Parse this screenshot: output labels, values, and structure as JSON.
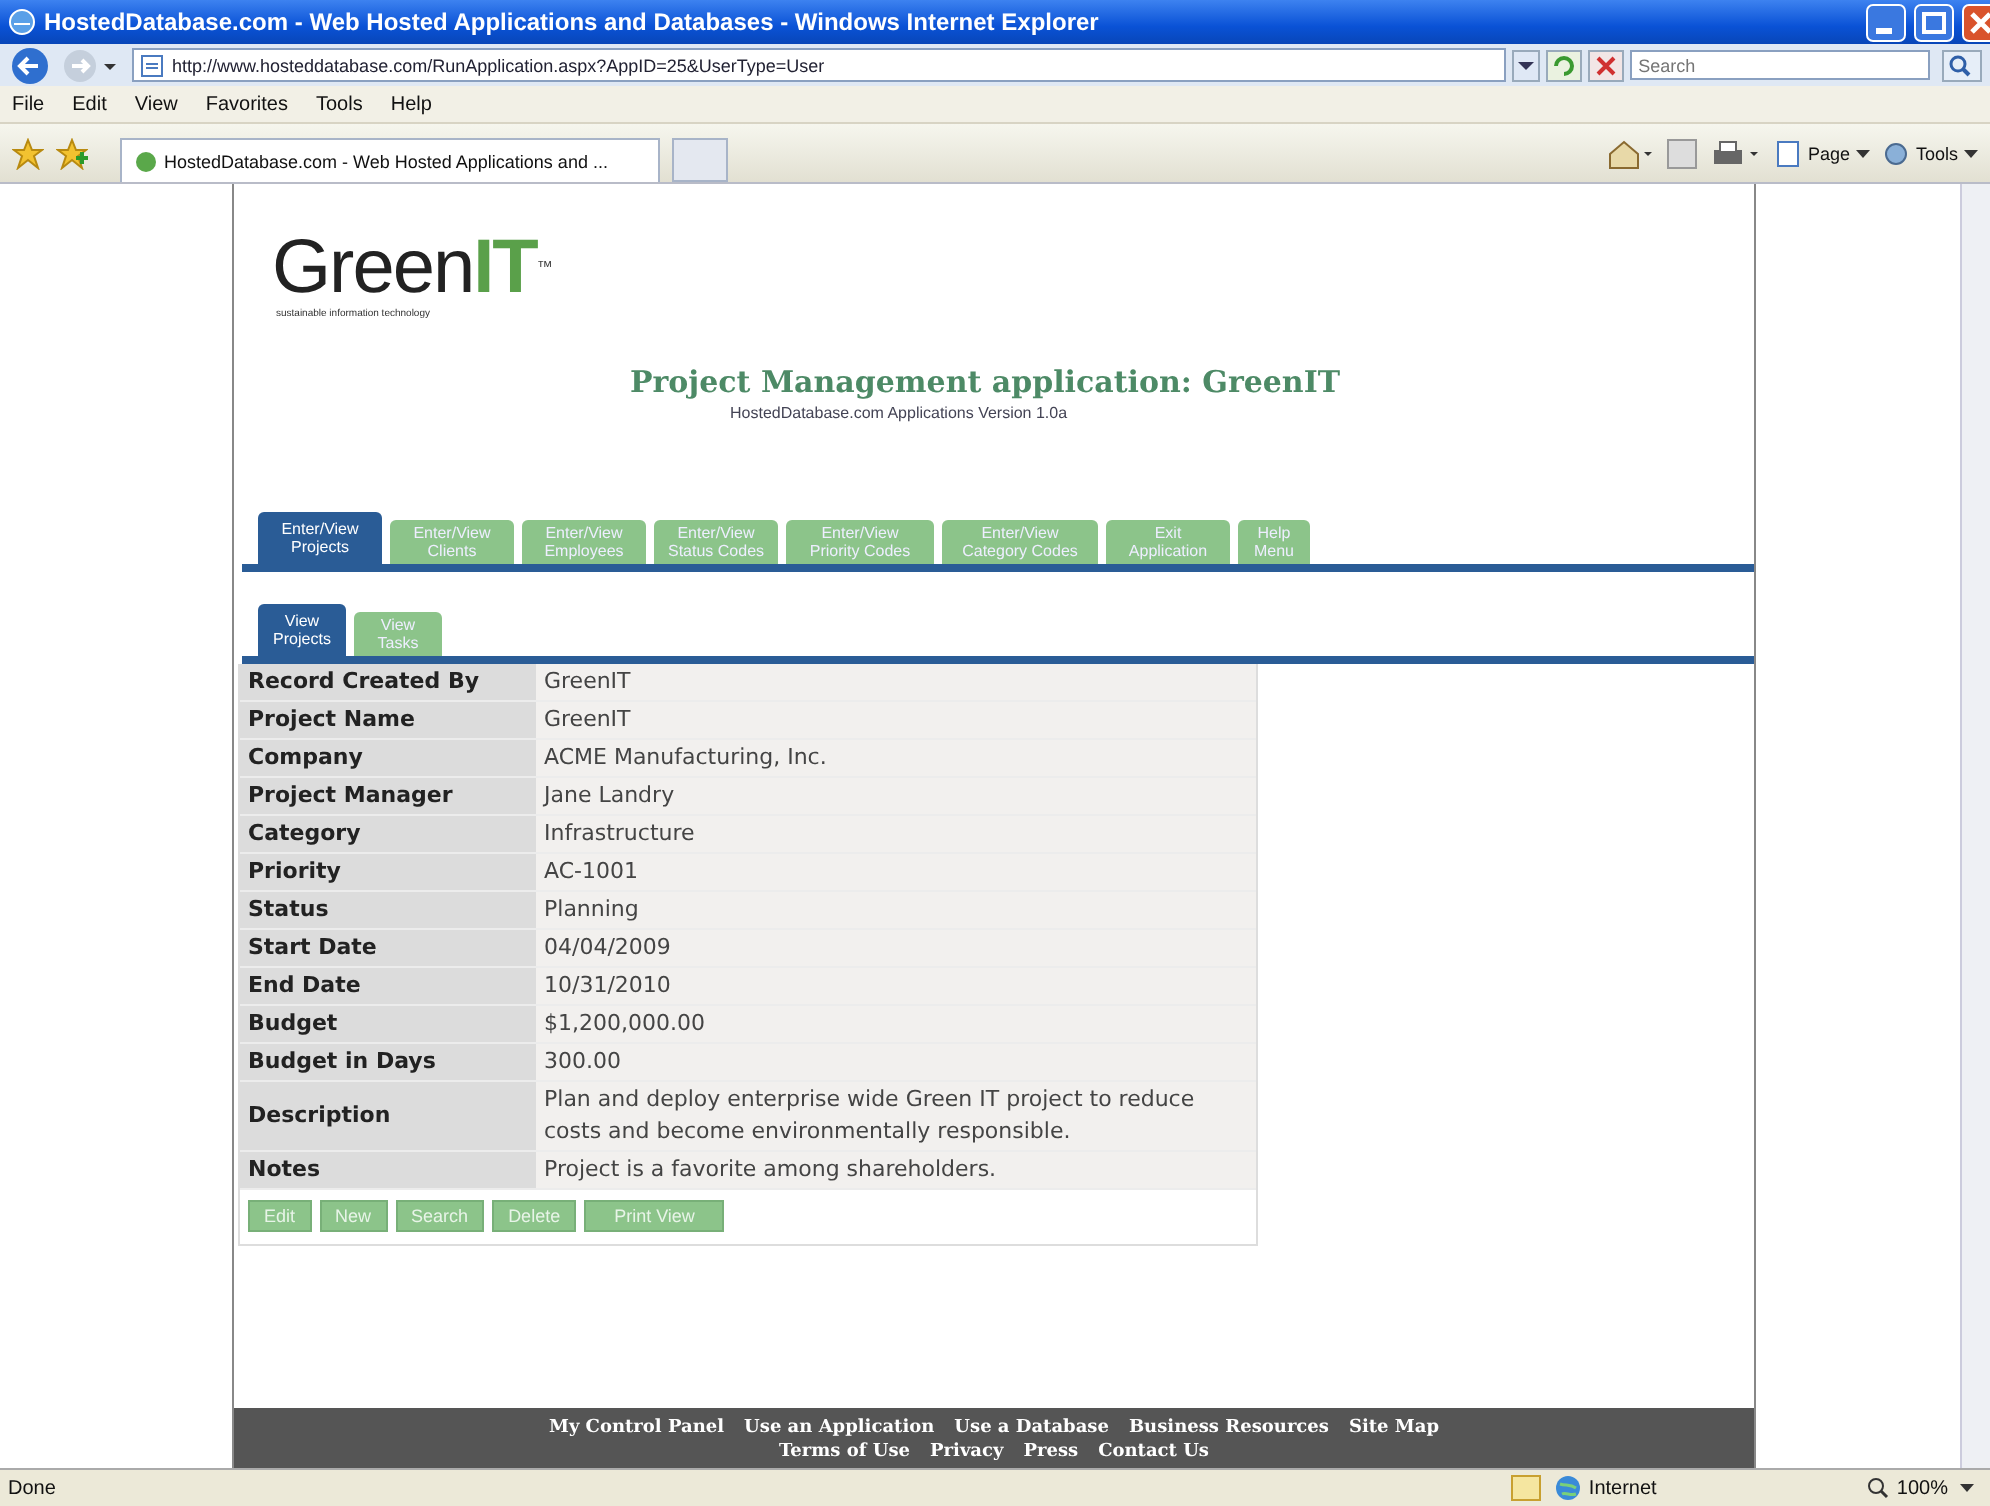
{
  "window": {
    "title": "HostedDatabase.com - Web Hosted Applications and Databases - Windows Internet Explorer"
  },
  "address_bar": {
    "url": "http://www.hosteddatabase.com/RunApplication.aspx?AppID=25&UserType=User"
  },
  "search": {
    "placeholder": "Search"
  },
  "menu": [
    "File",
    "Edit",
    "View",
    "Favorites",
    "Tools",
    "Help"
  ],
  "browser_tabs": [
    {
      "label": "HostedDatabase.com - Web Hosted Applications and ...",
      "selected": true
    }
  ],
  "command_bar": [
    "Page",
    "Tools"
  ],
  "page": {
    "logo": {
      "text": "Green",
      "accent": "IT",
      "mark": "™",
      "tagline": "sustainable information technology"
    },
    "title": "Project Management application: GreenIT",
    "subtitle": "HostedDatabase.com Applications Version 1.0a",
    "tabs": [
      {
        "label": "Enter/View Projects",
        "selected": true
      },
      {
        "label": "Enter/View Clients",
        "selected": false
      },
      {
        "label": "Enter/View Employees",
        "selected": false
      },
      {
        "label": "Enter/View Status Codes",
        "selected": false
      },
      {
        "label": "Enter/View Priority Codes",
        "selected": false
      },
      {
        "label": "Enter/View Category Codes",
        "selected": false
      },
      {
        "label": "Exit Application",
        "selected": false
      },
      {
        "label": "Help Menu",
        "selected": false
      }
    ],
    "subtabs": [
      {
        "label": "View Projects",
        "selected": true
      },
      {
        "label": "View Tasks",
        "selected": false
      }
    ],
    "record": [
      {
        "label": "Record Created By",
        "value": "GreenIT"
      },
      {
        "label": "Project Name",
        "value": "GreenIT"
      },
      {
        "label": "Company",
        "value": "ACME Manufacturing, Inc."
      },
      {
        "label": "Project Manager",
        "value": "Jane Landry"
      },
      {
        "label": "Category",
        "value": "Infrastructure"
      },
      {
        "label": "Priority",
        "value": "AC-1001"
      },
      {
        "label": "Status",
        "value": "Planning"
      },
      {
        "label": "Start Date",
        "value": "04/04/2009"
      },
      {
        "label": "End Date",
        "value": "10/31/2010"
      },
      {
        "label": "Budget",
        "value": "$1,200,000.00"
      },
      {
        "label": "Budget in Days",
        "value": "300.00"
      },
      {
        "label": "Description",
        "value": "Plan and deploy enterprise wide Green IT project to reduce costs and become environmentally responsible."
      },
      {
        "label": "Notes",
        "value": "Project is a favorite among shareholders."
      }
    ],
    "actions": [
      "Edit",
      "New",
      "Search",
      "Delete",
      "Print View"
    ],
    "footer_links": [
      "My Control Panel",
      "Use an Application",
      "Use a Database",
      "Business Resources",
      "Site Map"
    ],
    "footer_links_2": [
      "Terms of Use",
      "Privacy",
      "Press",
      "Contact Us"
    ]
  },
  "status_bar": {
    "text": "Done",
    "zone": "Internet",
    "zoom": "100%"
  }
}
